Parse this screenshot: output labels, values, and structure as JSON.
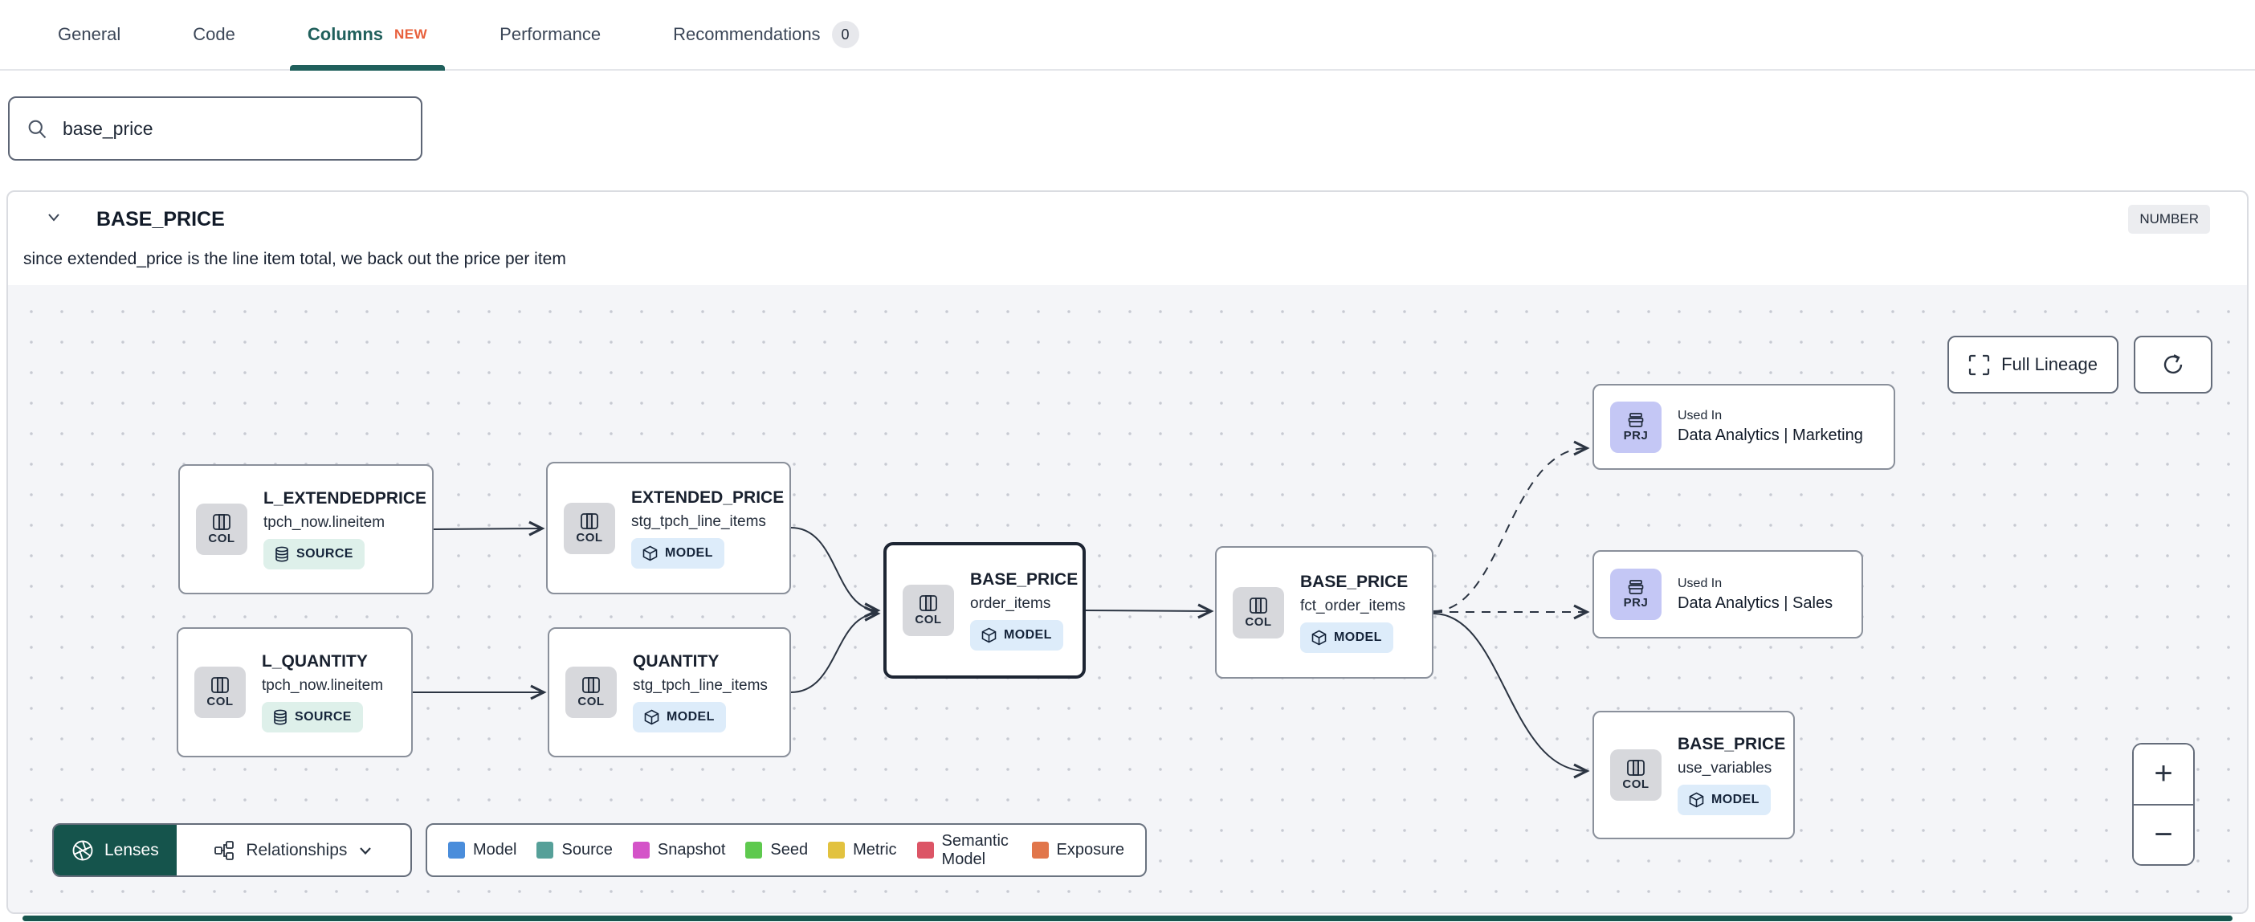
{
  "tabs": {
    "items": [
      {
        "label": "General"
      },
      {
        "label": "Code"
      },
      {
        "label": "Columns",
        "badge": "NEW"
      },
      {
        "label": "Performance"
      },
      {
        "label": "Recommendations",
        "count": "0"
      }
    ]
  },
  "search": {
    "value": "base_price"
  },
  "column_header": {
    "name": "BASE_PRICE",
    "type": "NUMBER",
    "description": "since extended_price is the line item total, we back out the price per item"
  },
  "lineage": {
    "nodes": [
      {
        "chip": "COL",
        "title": "L_EXTENDEDPRICE",
        "subtitle": "tpch_now.lineitem",
        "badge": "SOURCE"
      },
      {
        "chip": "COL",
        "title": "EXTENDED_PRICE",
        "subtitle": "stg_tpch_line_items",
        "badge": "MODEL"
      },
      {
        "chip": "COL",
        "title": "L_QUANTITY",
        "subtitle": "tpch_now.lineitem",
        "badge": "SOURCE"
      },
      {
        "chip": "COL",
        "title": "QUANTITY",
        "subtitle": "stg_tpch_line_items",
        "badge": "MODEL"
      },
      {
        "chip": "COL",
        "title": "BASE_PRICE",
        "subtitle": "order_items",
        "badge": "MODEL",
        "selected": true
      },
      {
        "chip": "COL",
        "title": "BASE_PRICE",
        "subtitle": "fct_order_items",
        "badge": "MODEL"
      },
      {
        "chip": "PRJ",
        "kicker": "Used In",
        "title": "Data Analytics | Marketing"
      },
      {
        "chip": "PRJ",
        "kicker": "Used In",
        "title": "Data Analytics | Sales"
      },
      {
        "chip": "COL",
        "title": "BASE_PRICE",
        "subtitle": "use_variables",
        "badge": "MODEL"
      }
    ],
    "controls": {
      "full_lineage": "Full Lineage",
      "zoom_in": "+",
      "zoom_out": "−"
    },
    "toolbar": {
      "lenses": "Lenses",
      "relationships": "Relationships"
    },
    "legend": {
      "items": [
        {
          "label": "Model",
          "color": "#4a8ddb"
        },
        {
          "label": "Source",
          "color": "#56a099"
        },
        {
          "label": "Snapshot",
          "color": "#d453c8"
        },
        {
          "label": "Seed",
          "color": "#5ec94e"
        },
        {
          "label": "Metric",
          "color": "#e2c23f"
        },
        {
          "label": "Semantic Model",
          "color": "#dc5566"
        },
        {
          "label": "Exposure",
          "color": "#e1764b"
        }
      ]
    }
  },
  "icons": {
    "search": "magnifier",
    "chevron_down": "chevron-down",
    "full_lineage": "fullscreen-brackets",
    "refresh": "circular-arrow",
    "lenses": "aperture",
    "relationships": "node-graph",
    "col": "table-columns",
    "prj": "archive-box",
    "model": "cube",
    "source": "database-cylinder"
  },
  "colors": {
    "accent_teal": "#20605c",
    "lenses_green": "#15544c",
    "new_badge": "#e8603c",
    "model_badge_bg": "#ddecfa",
    "source_badge_bg": "#def0ea",
    "col_chip_bg": "#d7d8dc",
    "prj_chip_bg": "#c4c7f5",
    "canvas_bg": "#f4f5f8"
  }
}
